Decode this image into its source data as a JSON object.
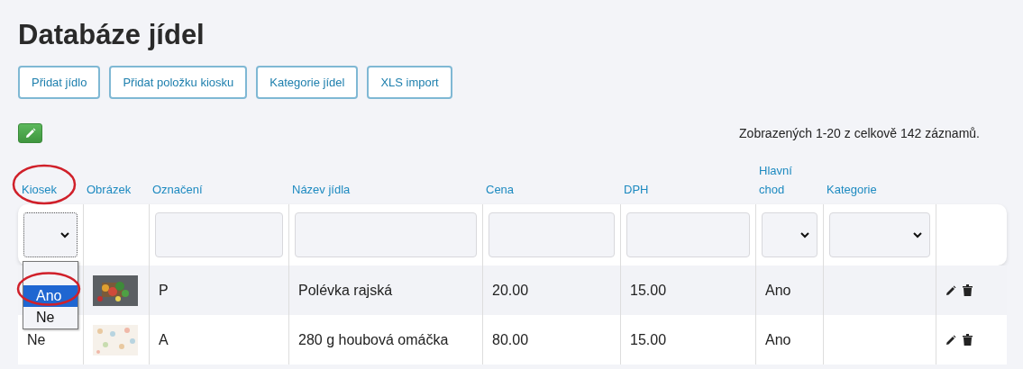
{
  "title": "Databáze jídel",
  "buttons": [
    "Přidat jídlo",
    "Přidat položku kiosku",
    "Kategorie jídel",
    "XLS import"
  ],
  "summary": "Zobrazených 1-20 z celkově 142 záznamů.",
  "columns": [
    {
      "label": "Kiosek",
      "kind": "select"
    },
    {
      "label": "Obrázek",
      "kind": "none"
    },
    {
      "label": "Označení",
      "kind": "text"
    },
    {
      "label": "Název jídla",
      "kind": "text"
    },
    {
      "label": "Cena",
      "kind": "text"
    },
    {
      "label": "DPH",
      "kind": "text"
    },
    {
      "label": "Hlavní chod",
      "kind": "select"
    },
    {
      "label": "Kategorie",
      "kind": "select"
    },
    {
      "kind": "none"
    }
  ],
  "dropdown": {
    "options": [
      {
        "label": "Ano",
        "selected": true
      },
      {
        "label": "Ne",
        "selected": false
      }
    ]
  },
  "rows": [
    {
      "code": "P",
      "name": "Polévka rajská",
      "price": "20.00",
      "vat": "15.00",
      "main": "Ano"
    },
    {
      "kiosk": "Ne",
      "code": "A",
      "name": "280 g houbová omáčka",
      "price": "80.00",
      "vat": "15.00",
      "main": "Ano"
    }
  ]
}
